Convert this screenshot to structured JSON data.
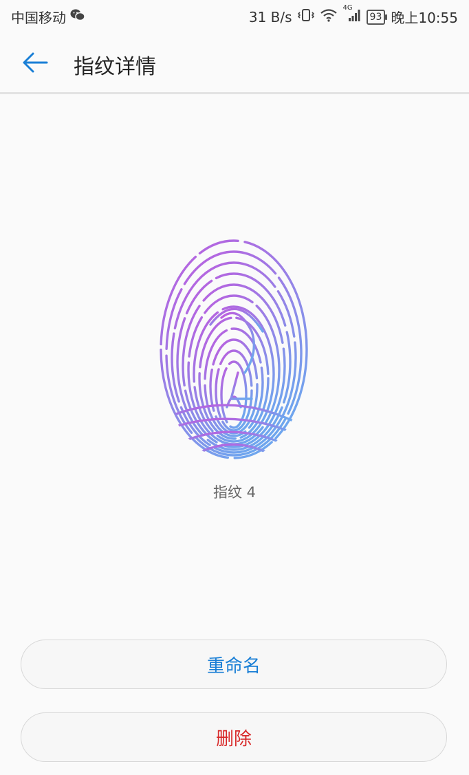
{
  "status_bar": {
    "carrier": "中国移动",
    "net_speed": "31 B/s",
    "network_type": "4G",
    "battery": "93",
    "time": "晚上10:55",
    "icons": [
      "wechat-icon",
      "vibrate-icon",
      "wifi-icon",
      "signal-icon",
      "battery-icon"
    ]
  },
  "toolbar": {
    "title": "指纹详情",
    "back_icon": "back-arrow-icon"
  },
  "fingerprint": {
    "icon": "fingerprint-icon",
    "name": "指纹 4",
    "gradient": [
      "#c05bde",
      "#6fa6ee"
    ]
  },
  "actions": {
    "rename": "重命名",
    "delete": "删除",
    "rename_color": "#1a7fd6",
    "delete_color": "#d82a2a"
  }
}
